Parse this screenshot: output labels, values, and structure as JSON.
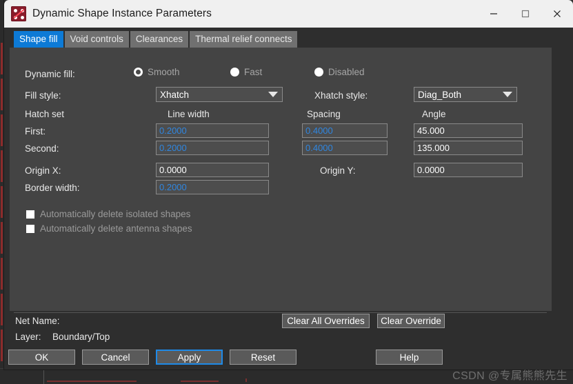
{
  "window": {
    "title": "Dynamic Shape Instance Parameters",
    "icon": "pads-shape-icon",
    "controls": {
      "minimize": "minimize-icon",
      "maximize": "maximize-icon",
      "close": "close-icon"
    }
  },
  "tabs": [
    {
      "label": "Shape fill",
      "active": true
    },
    {
      "label": "Void controls",
      "active": false
    },
    {
      "label": "Clearances",
      "active": false
    },
    {
      "label": "Thermal relief connects",
      "active": false
    }
  ],
  "form": {
    "dynamic_fill_label": "Dynamic fill:",
    "dynamic_fill_options": [
      {
        "label": "Smooth",
        "selected": true
      },
      {
        "label": "Fast",
        "selected": false
      },
      {
        "label": "Disabled",
        "selected": false
      }
    ],
    "fill_style_label": "Fill style:",
    "fill_style_value": "Xhatch",
    "xhatch_style_label": "Xhatch style:",
    "xhatch_style_value": "Diag_Both",
    "hatch_set_label": "Hatch set",
    "line_width_header": "Line width",
    "spacing_header": "Spacing",
    "angle_header": "Angle",
    "first_label": "First:",
    "second_label": "Second:",
    "first_line_width": "0.2000",
    "second_line_width": "0.2000",
    "first_spacing": "0.4000",
    "second_spacing": "0.4000",
    "first_angle": "45.000",
    "second_angle": "135.000",
    "origin_x_label": "Origin X:",
    "origin_x_value": "0.0000",
    "origin_y_label": "Origin Y:",
    "origin_y_value": "0.0000",
    "border_width_label": "Border width:",
    "border_width_value": "0.2000",
    "checkboxes": [
      {
        "label": "Automatically delete isolated shapes",
        "checked": false
      },
      {
        "label": "Automatically delete antenna shapes",
        "checked": false
      }
    ]
  },
  "footer": {
    "net_name_label": "Net Name:",
    "net_name_value": "",
    "layer_label": "Layer:",
    "layer_value": "Boundary/Top",
    "clear_all_overrides": "Clear All Overrides",
    "clear_override": "Clear Override",
    "ok": "OK",
    "cancel": "Cancel",
    "apply": "Apply",
    "reset": "Reset",
    "help": "Help"
  },
  "watermark": "CSDN @专属熊熊先生",
  "colors": {
    "accent": "#0d7ad6",
    "override_text": "#2f86e0",
    "panel_bg": "#444444",
    "dialog_bg": "#2e2e2e",
    "titlebar_bg": "#f0f0f0"
  }
}
